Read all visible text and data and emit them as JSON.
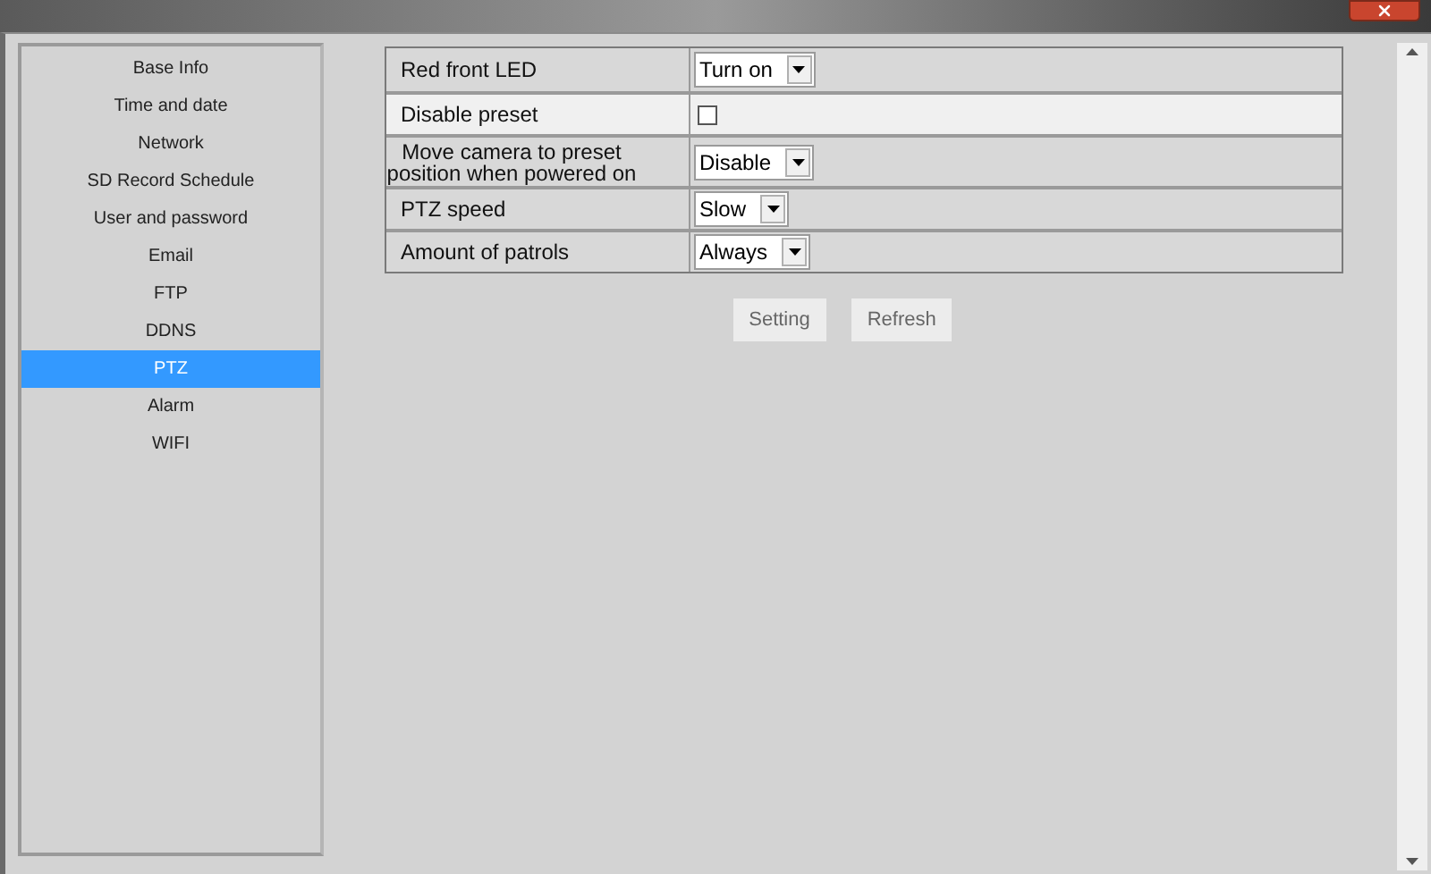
{
  "sidebar": {
    "items": [
      {
        "label": "Base Info",
        "selected": false
      },
      {
        "label": "Time and date",
        "selected": false
      },
      {
        "label": "Network",
        "selected": false
      },
      {
        "label": "SD Record Schedule",
        "selected": false
      },
      {
        "label": "User and password",
        "selected": false
      },
      {
        "label": "Email",
        "selected": false
      },
      {
        "label": "FTP",
        "selected": false
      },
      {
        "label": "DDNS",
        "selected": false
      },
      {
        "label": "PTZ",
        "selected": true
      },
      {
        "label": "Alarm",
        "selected": false
      },
      {
        "label": "WIFI",
        "selected": false
      }
    ]
  },
  "settings": [
    {
      "kind": "select",
      "label": "Red front LED",
      "value": "Turn on"
    },
    {
      "kind": "checkbox",
      "label": "Disable preset",
      "checked": false
    },
    {
      "kind": "select",
      "label": "Move camera to preset position when powered on",
      "value": "Disable"
    },
    {
      "kind": "select",
      "label": "PTZ speed",
      "value": "Slow"
    },
    {
      "kind": "select",
      "label": "Amount of patrols",
      "value": "Always"
    }
  ],
  "buttons": [
    "Setting",
    "Refresh"
  ]
}
